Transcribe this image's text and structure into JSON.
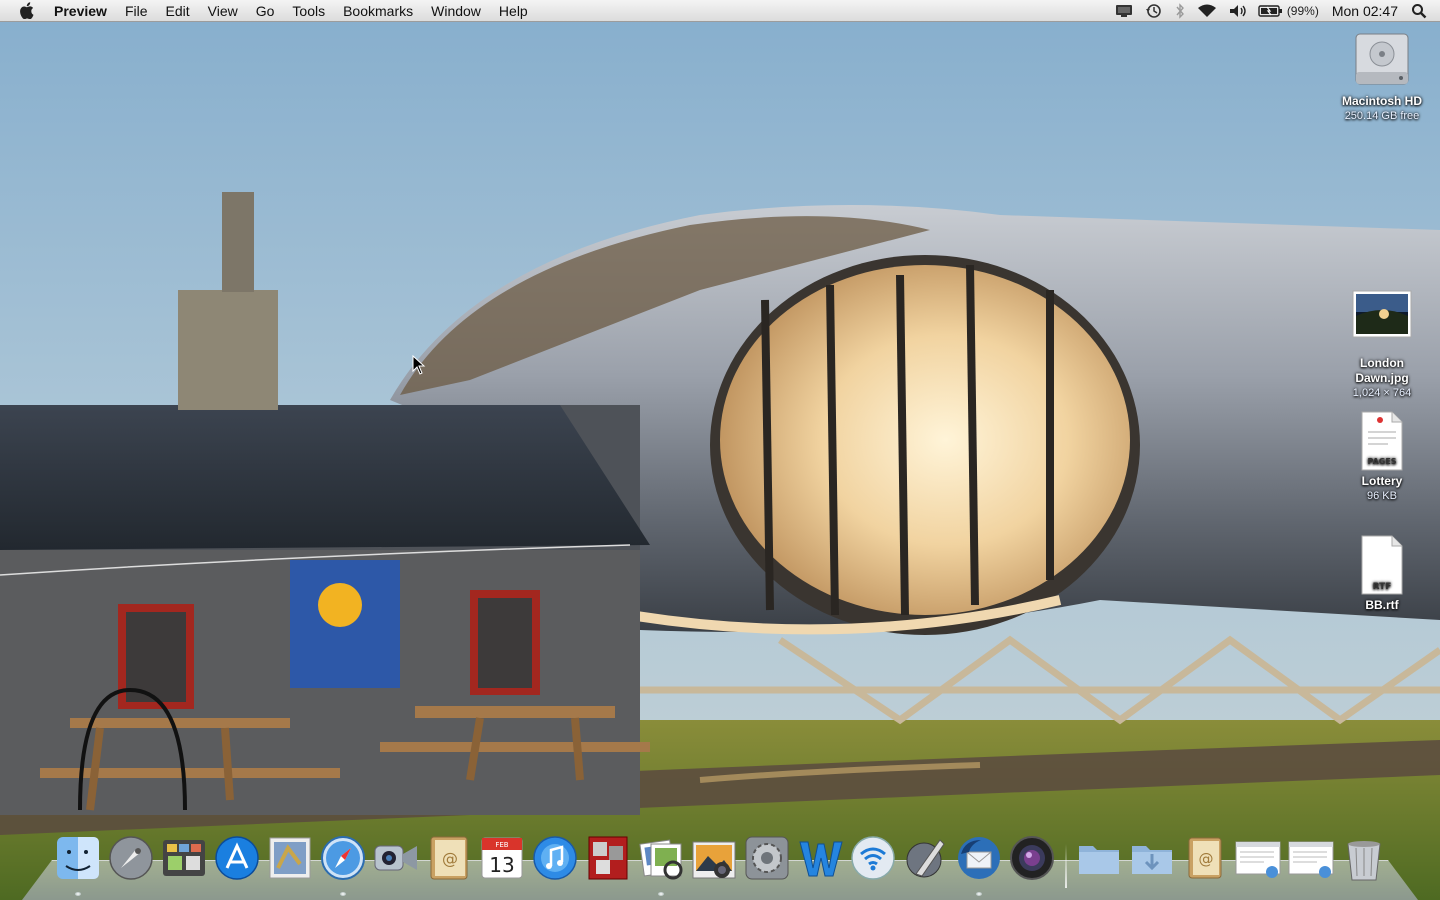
{
  "menubar": {
    "apple_icon": "apple-logo",
    "app_name": "Preview",
    "menus": [
      "File",
      "Edit",
      "View",
      "Go",
      "Tools",
      "Bookmarks",
      "Window",
      "Help"
    ],
    "status_icons": [
      "display-mirroring-icon",
      "time-machine-icon",
      "bluetooth-icon",
      "wifi-icon",
      "volume-icon",
      "battery-icon"
    ],
    "battery_percent": "(99%)",
    "clock": "Mon 02:47",
    "search_icon": "spotlight-icon"
  },
  "desktop_icons": [
    {
      "name": "Macintosh HD",
      "detail": "250.14 GB free",
      "icon": "hard-drive-icon"
    },
    {
      "name": "London Dawn.jpg",
      "name_lines": [
        "London",
        "Dawn.jpg"
      ],
      "detail": "1,024 × 764",
      "icon": "image-thumbnail-icon"
    },
    {
      "name": "Lottery",
      "detail": "96 KB",
      "icon": "pages-document-icon",
      "badge": "PAGES"
    },
    {
      "name": "BB.rtf",
      "detail": "",
      "icon": "rtf-document-icon",
      "badge": "RTF"
    }
  ],
  "dock": {
    "apps": [
      {
        "name": "Finder",
        "icon": "finder-icon",
        "running": true
      },
      {
        "name": "Launchpad",
        "icon": "launchpad-icon",
        "running": false
      },
      {
        "name": "Mission Control",
        "icon": "mission-control-icon",
        "running": false
      },
      {
        "name": "App Store",
        "icon": "app-store-icon",
        "running": false
      },
      {
        "name": "Mail",
        "icon": "mail-stamp-icon",
        "running": false
      },
      {
        "name": "Safari",
        "icon": "safari-icon",
        "running": true
      },
      {
        "name": "FaceTime",
        "icon": "facetime-icon",
        "running": false
      },
      {
        "name": "Address Book",
        "icon": "address-book-icon",
        "running": false
      },
      {
        "name": "iCal",
        "icon": "calendar-icon",
        "running": false,
        "date": "13",
        "month": "FEB"
      },
      {
        "name": "iTunes",
        "icon": "itunes-icon",
        "running": false
      },
      {
        "name": "Photo Booth",
        "icon": "photo-booth-icon",
        "running": false
      },
      {
        "name": "Preview",
        "icon": "preview-icon",
        "running": true
      },
      {
        "name": "iPhoto",
        "icon": "iphoto-icon",
        "running": false
      },
      {
        "name": "System Preferences",
        "icon": "system-preferences-icon",
        "running": false
      },
      {
        "name": "Word",
        "icon": "word-w-icon",
        "running": false
      },
      {
        "name": "Wi-Fi",
        "icon": "wifi-app-icon",
        "running": false
      },
      {
        "name": "Script Editor",
        "icon": "script-editor-icon",
        "running": false
      },
      {
        "name": "Thunderbird",
        "icon": "thunderbird-icon",
        "running": true
      },
      {
        "name": "Aperture",
        "icon": "aperture-lens-icon",
        "running": false
      }
    ],
    "stacks": [
      {
        "name": "Applications",
        "icon": "folder-icon"
      },
      {
        "name": "Downloads",
        "icon": "downloads-folder-icon"
      },
      {
        "name": "Contacts",
        "icon": "contacts-card-icon"
      },
      {
        "name": "Document 1",
        "icon": "document-stack-icon"
      },
      {
        "name": "Document 2",
        "icon": "document-stack-icon-2"
      },
      {
        "name": "Trash",
        "icon": "trash-icon"
      }
    ]
  }
}
